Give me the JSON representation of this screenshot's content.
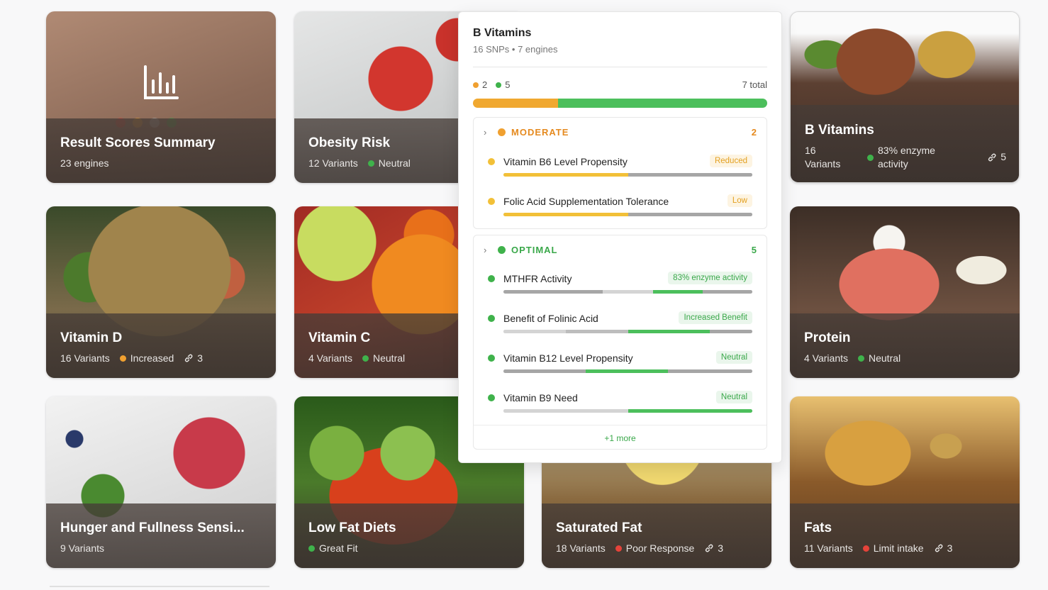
{
  "cards": {
    "summary": {
      "title": "Result Scores Summary",
      "sub": "23 engines"
    },
    "obesity": {
      "title": "Obesity Risk",
      "variants": "12 Variants",
      "status": "Neutral"
    },
    "bvit": {
      "title": "B Vitamins",
      "variants_l1": "16",
      "variants_l2": "Variants",
      "status_l1": "83% enzyme",
      "status_l2": "activity",
      "links": "5"
    },
    "vitd": {
      "title": "Vitamin D",
      "variants": "16 Variants",
      "status": "Increased",
      "links": "3"
    },
    "vitc": {
      "title": "Vitamin C",
      "variants": "4 Variants",
      "status": "Neutral"
    },
    "protein": {
      "title": "Protein",
      "variants": "4 Variants",
      "status": "Neutral"
    },
    "hunger": {
      "title": "Hunger and Fullness Sensi...",
      "variants": "9 Variants"
    },
    "lowfat": {
      "title": "Low Fat Diets",
      "status": "Great Fit"
    },
    "satfat": {
      "title": "Saturated Fat",
      "variants": "18 Variants",
      "status": "Poor Response",
      "links": "3"
    },
    "fats": {
      "title": "Fats",
      "variants": "11 Variants",
      "status": "Limit intake",
      "links": "3"
    }
  },
  "popup": {
    "title": "B Vitamins",
    "subtitle": "16 SNPs • 7 engines",
    "moderate_count": "2",
    "optimal_count": "5",
    "total": "7 total",
    "moderate_fraction": 0.29,
    "groups": {
      "moderate": {
        "label": "MODERATE",
        "count": "2",
        "items": [
          {
            "name": "Vitamin B6 Level Propensity",
            "badge": "Reduced"
          },
          {
            "name": "Folic Acid Supplementation Tolerance",
            "badge": "Low"
          }
        ]
      },
      "optimal": {
        "label": "OPTIMAL",
        "count": "5",
        "items": [
          {
            "name": "MTHFR Activity",
            "badge": "83% enzyme activity"
          },
          {
            "name": "Benefit of Folinic Acid",
            "badge": "Increased Benefit"
          },
          {
            "name": "Vitamin B12 Level Propensity",
            "badge": "Neutral"
          },
          {
            "name": "Vitamin B9 Need",
            "badge": "Neutral"
          }
        ]
      }
    },
    "more": "+1 more"
  },
  "colors": {
    "moderate": "#f0a830",
    "optimal": "#4cbf5c",
    "poor": "#e5433a"
  },
  "icons": [
    "bar-chart-icon",
    "link-icon",
    "chevron-right-icon"
  ]
}
